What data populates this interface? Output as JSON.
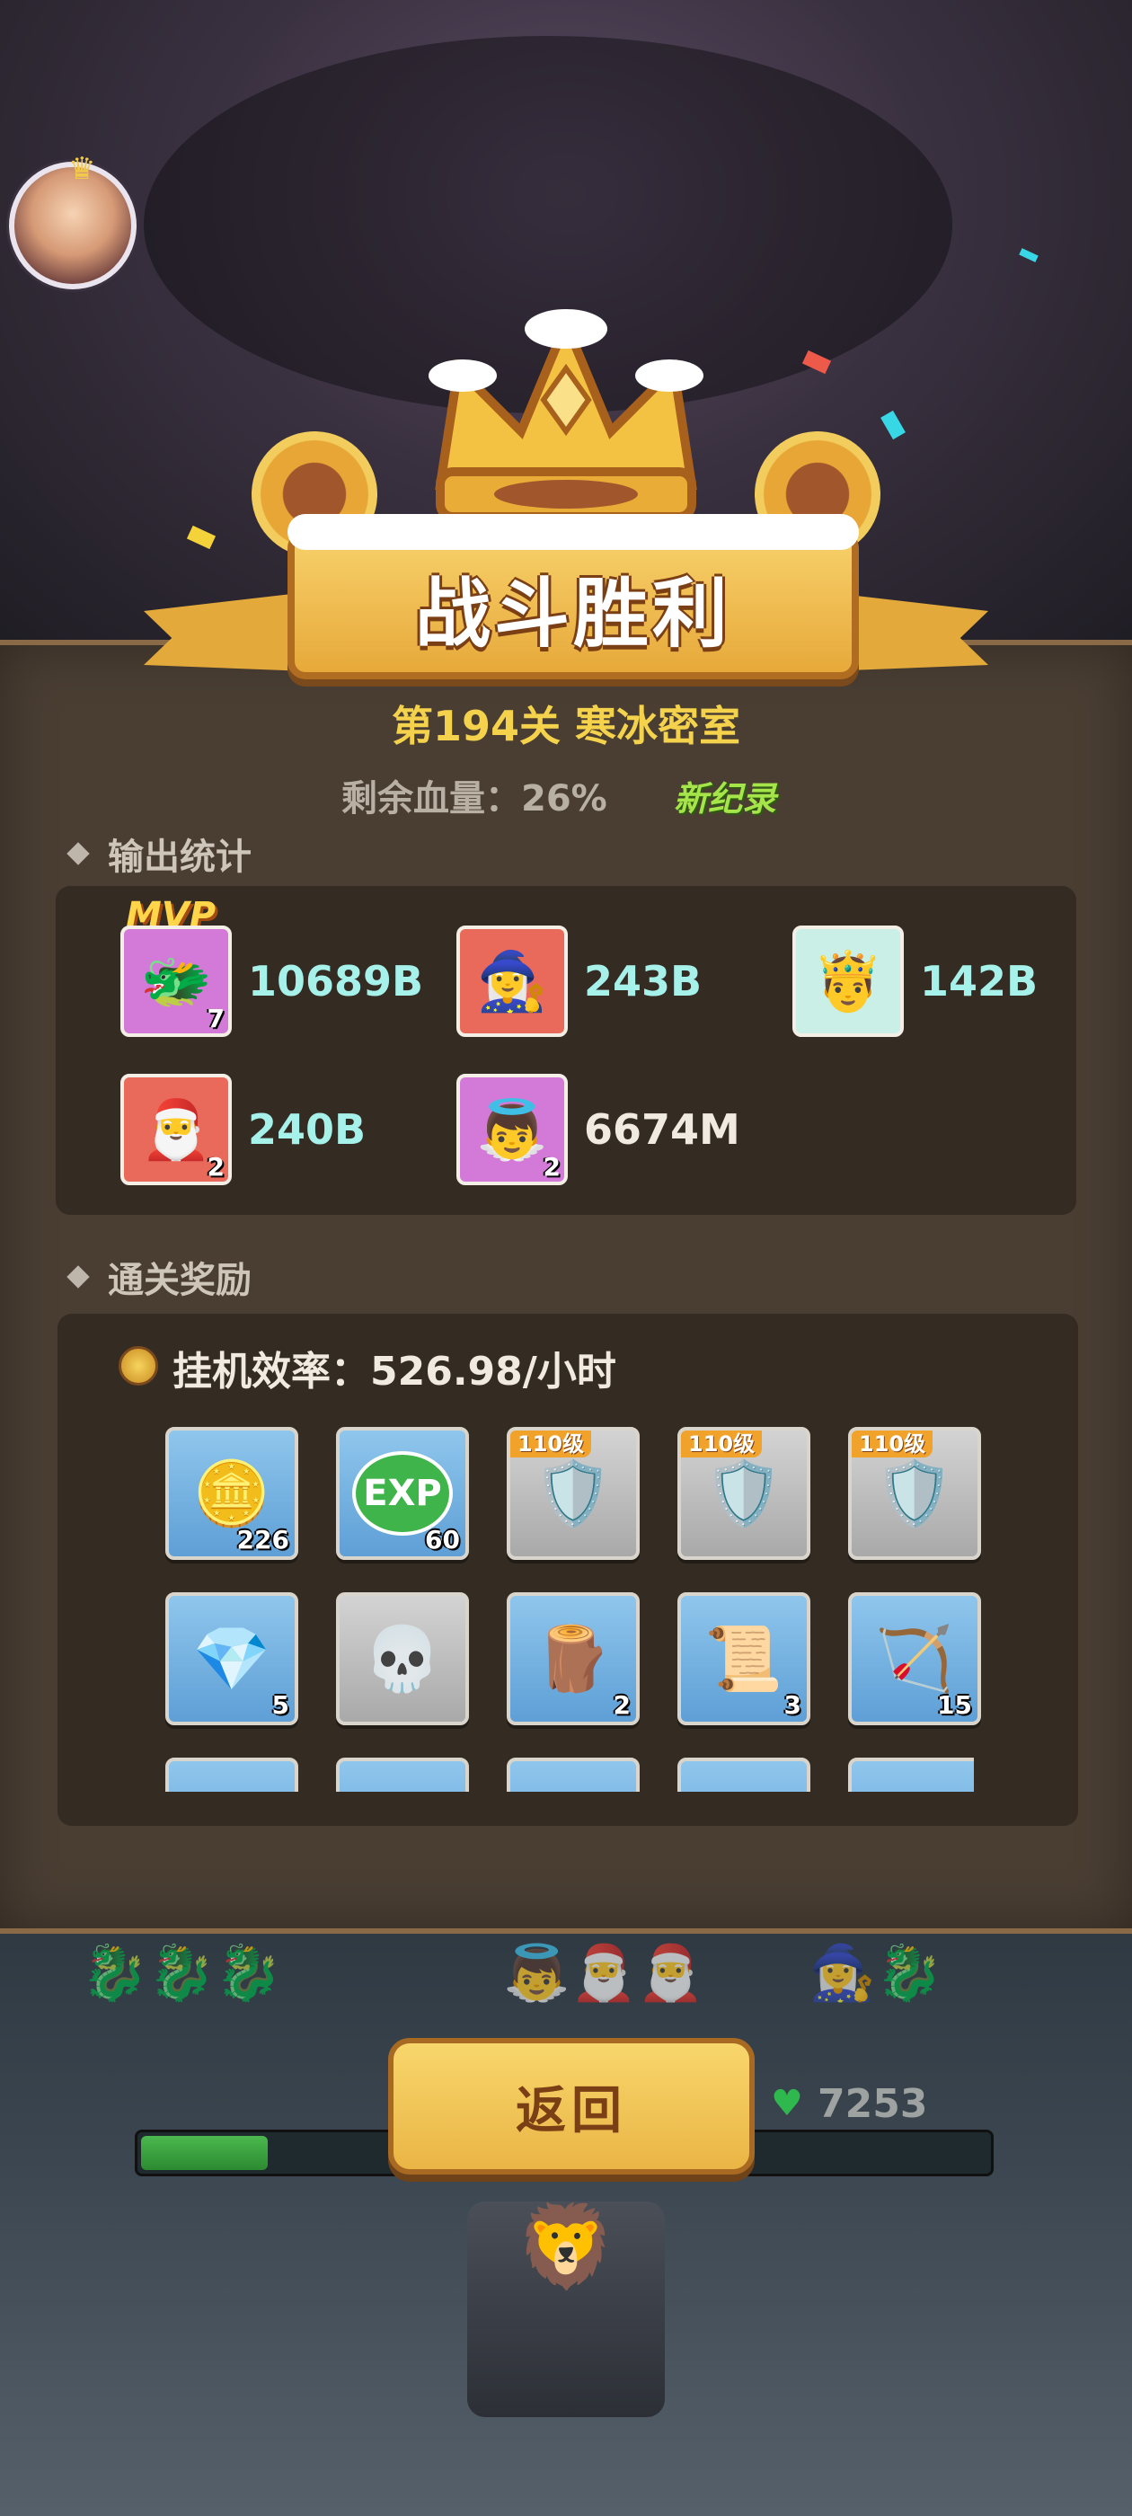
{
  "banner": {
    "title": "战斗胜利"
  },
  "level": {
    "title": "第194关 寒冰密室",
    "hp_remaining": "剩余血量：26%",
    "record_badge": "新纪录"
  },
  "output_stats": {
    "header": "输出统计",
    "mvp_label": "MVP",
    "heroes": [
      {
        "damage": "10689B",
        "level": "7",
        "portrait_icon": "blue-dragon-icon",
        "color": "#a6f2ea"
      },
      {
        "damage": "243B",
        "level": "",
        "portrait_icon": "ice-mage-girl-icon",
        "color": "#a6f2ea"
      },
      {
        "damage": "142B",
        "level": "",
        "portrait_icon": "king-swordsman-icon",
        "color": "#a6f2ea"
      },
      {
        "damage": "240B",
        "level": "2",
        "portrait_icon": "santa-hero-icon",
        "color": "#a6f2ea"
      },
      {
        "damage": "6674M",
        "level": "2",
        "portrait_icon": "angel-hero-icon",
        "color": "#f0eae0"
      }
    ]
  },
  "rewards": {
    "header": "通关奖励",
    "efficiency": "挂机效率：526.98/小时",
    "items": [
      {
        "icon": "gold-coin-icon",
        "count": "226",
        "tag": "",
        "bg": "blue"
      },
      {
        "icon": "exp-orb-icon",
        "count": "60",
        "tag": "",
        "bg": "blue"
      },
      {
        "icon": "red-armor-icon",
        "count": "",
        "tag": "110级",
        "bg": "grey"
      },
      {
        "icon": "red-armor-icon",
        "count": "",
        "tag": "110级",
        "bg": "grey"
      },
      {
        "icon": "red-armor-icon",
        "count": "",
        "tag": "110级",
        "bg": "grey"
      },
      {
        "icon": "purple-crystal-icon",
        "count": "5",
        "tag": "",
        "bg": "blue"
      },
      {
        "icon": "beast-skull-icon",
        "count": "",
        "tag": "",
        "bg": "grey"
      },
      {
        "icon": "purple-log-icon",
        "count": "2",
        "tag": "",
        "bg": "blue"
      },
      {
        "icon": "blue-scroll-icon",
        "count": "3",
        "tag": "",
        "bg": "blue"
      },
      {
        "icon": "green-bow-orb-icon",
        "count": "15",
        "tag": "",
        "bg": "blue"
      }
    ]
  },
  "bottom": {
    "return_label": "返回",
    "hp_value": "7253",
    "hp_fill": 0.15
  },
  "colors": {
    "accent_gold": "#f5d24c",
    "damage_cyan": "#a6f2ea",
    "record_green": "#a6e54a"
  }
}
